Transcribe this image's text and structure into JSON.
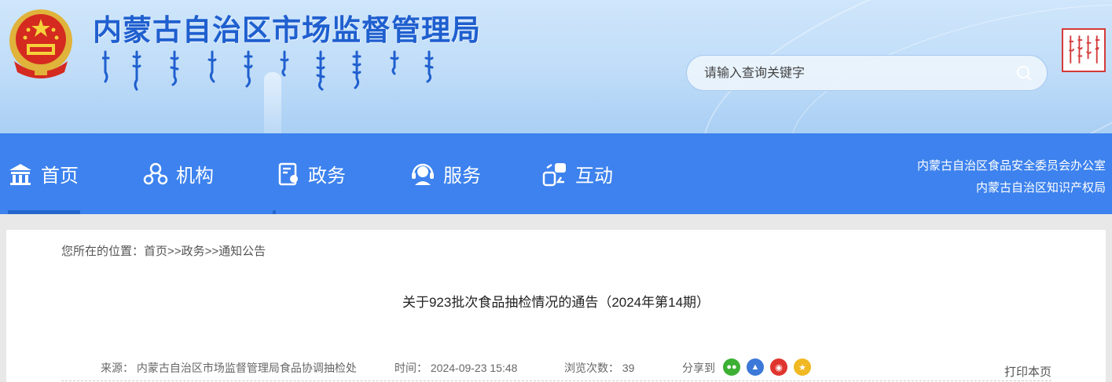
{
  "header": {
    "site_title": "内蒙古自治区市场监督管理局",
    "search_placeholder": "请输入查询关键字",
    "emblem_icon": "national-emblem-icon",
    "seal_icon": "mongolian-seal-icon"
  },
  "nav": {
    "items": [
      {
        "label": "首页",
        "icon": "building-icon"
      },
      {
        "label": "机构",
        "icon": "org-people-icon"
      },
      {
        "label": "政务",
        "icon": "document-stamp-icon"
      },
      {
        "label": "服务",
        "icon": "headset-icon"
      },
      {
        "label": "互动",
        "icon": "interaction-icon"
      }
    ],
    "links": [
      "内蒙古自治区食品安全委员会办公室",
      "内蒙古自治区知识产权局"
    ]
  },
  "breadcrumb": {
    "prefix": "您所在的位置：",
    "path": [
      "首页",
      "政务",
      "通知公告"
    ],
    "separator": ">>"
  },
  "article": {
    "title": "关于923批次食品抽检情况的通告（2024年第14期）",
    "source_label": "来源：",
    "source_value": "内蒙古自治区市场监督管理局食品协调抽检处",
    "time_label": "时间：",
    "time_value": "2024-09-23 15:48",
    "views_label": "浏览次数：",
    "views_value": "39",
    "share_label": "分享到",
    "share_icons": [
      "wechat-icon",
      "qq-icon",
      "weibo-icon",
      "qzone-icon"
    ],
    "print_label": "打印本页"
  },
  "colors": {
    "nav_bg": "#3d82ee",
    "title_blue": "#1f5fcf",
    "wechat": "#3cb034",
    "qq": "#3b78d8",
    "weibo": "#e0342e",
    "qzone": "#f0b823"
  }
}
